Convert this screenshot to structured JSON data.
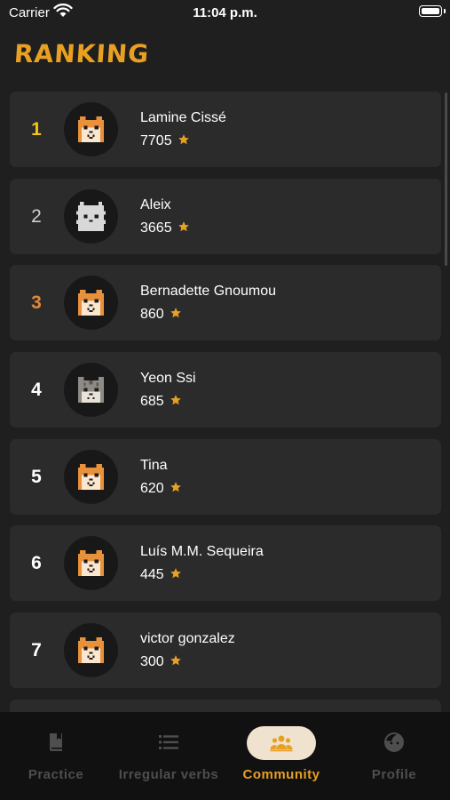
{
  "status_bar": {
    "carrier": "Carrier",
    "time": "11:04 p.m."
  },
  "title": "RANKING",
  "colors": {
    "accent": "#e8a023",
    "gold": "#f5c518",
    "bronze": "#e0883a",
    "card": "#2b2b2b"
  },
  "ranking": [
    {
      "rank": "1",
      "name": "Lamine Cissé",
      "score": "7705",
      "avatar": "shiba-icon"
    },
    {
      "rank": "2",
      "name": "Aleix",
      "score": "3665",
      "avatar": "white-dog-icon"
    },
    {
      "rank": "3",
      "name": "Bernadette Gnoumou",
      "score": "860",
      "avatar": "shiba-icon"
    },
    {
      "rank": "4",
      "name": "Yeon Ssi",
      "score": "685",
      "avatar": "gray-cat-icon"
    },
    {
      "rank": "5",
      "name": "Tina",
      "score": "620",
      "avatar": "shiba-icon"
    },
    {
      "rank": "6",
      "name": "Luís M.M. Sequeira",
      "score": "445",
      "avatar": "shiba-icon"
    },
    {
      "rank": "7",
      "name": "victor gonzalez",
      "score": "300",
      "avatar": "shiba-icon"
    }
  ],
  "tabs": [
    {
      "label": "Practice",
      "icon": "book-icon",
      "active": false
    },
    {
      "label": "Irregular verbs",
      "icon": "list-icon",
      "active": false
    },
    {
      "label": "Community",
      "icon": "people-icon",
      "active": true
    },
    {
      "label": "Profile",
      "icon": "profile-face-icon",
      "active": false
    }
  ]
}
